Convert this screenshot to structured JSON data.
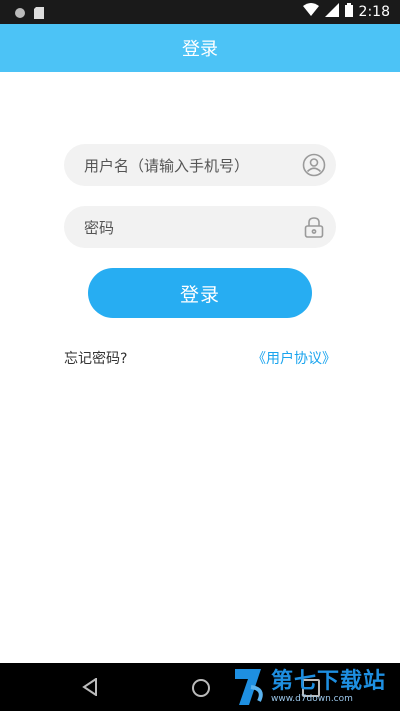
{
  "statusbar": {
    "time": "2:18"
  },
  "header": {
    "title": "登录"
  },
  "form": {
    "username_placeholder": "用户名（请输入手机号）",
    "password_placeholder": "密码",
    "login_label": "登录"
  },
  "links": {
    "forgot": "忘记密码?",
    "agreement": "《用户协议》"
  },
  "watermark": {
    "brand": "第七下载站",
    "url": "www.d7down.com"
  },
  "colors": {
    "titlebar": "#4cc3f6",
    "button": "#27adf2",
    "link": "#1aa4ee",
    "field_bg": "#f2f2f2"
  }
}
